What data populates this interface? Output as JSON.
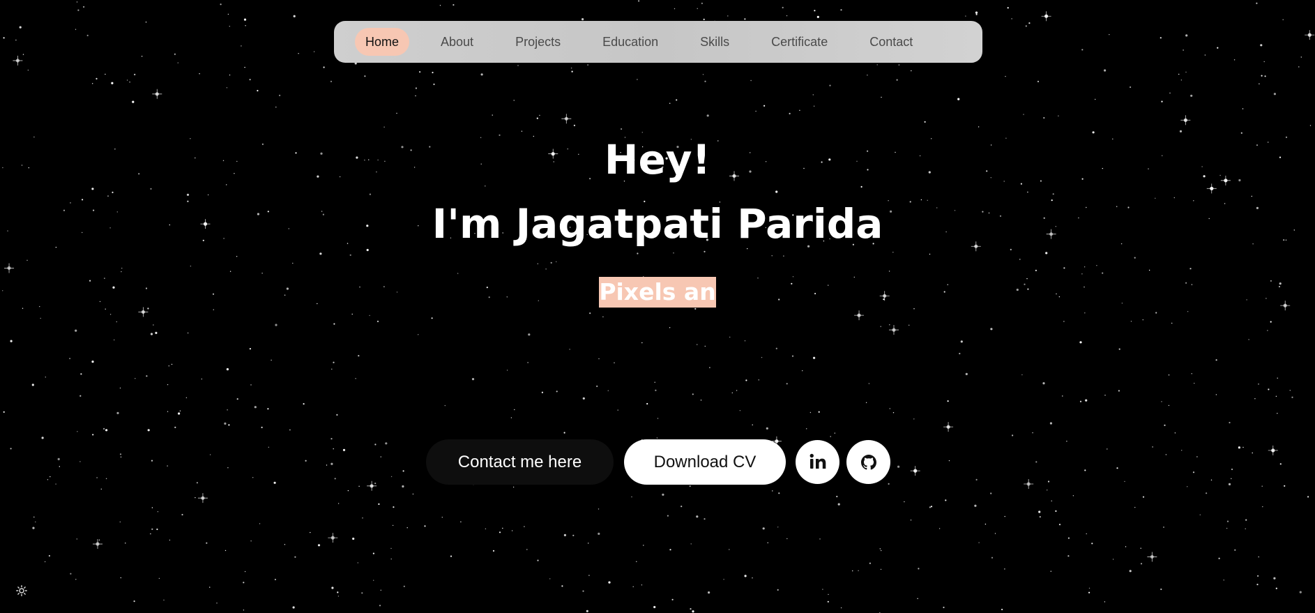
{
  "nav": {
    "items": [
      {
        "label": "Home",
        "active": true
      },
      {
        "label": "About",
        "active": false
      },
      {
        "label": "Projects",
        "active": false
      },
      {
        "label": "Education",
        "active": false
      },
      {
        "label": "Skills",
        "active": false
      },
      {
        "label": "Certificate",
        "active": false
      },
      {
        "label": "Contact",
        "active": false
      }
    ],
    "active_color": "#f7c7b3"
  },
  "hero": {
    "greeting": "Hey!",
    "name_line": "I'm Jagatpati Parida",
    "typed_text": "Pixels an",
    "typed_highlight_color": "#f7c7b3"
  },
  "actions": {
    "contact_label": "Contact me here",
    "cv_label": "Download CV",
    "linkedin_icon": "linkedin-icon",
    "github_icon": "github-icon"
  },
  "theme": {
    "toggle_icon": "sun-icon",
    "background": "#000000"
  }
}
